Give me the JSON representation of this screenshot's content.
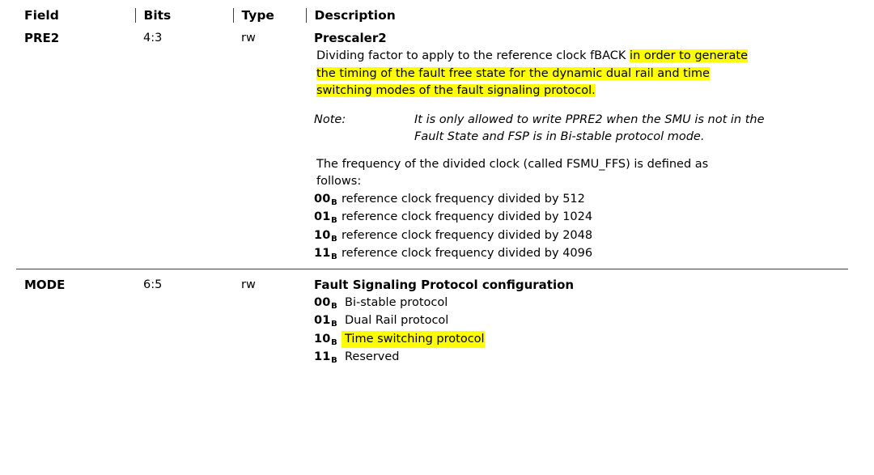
{
  "table": {
    "columns": [
      {
        "key": "field",
        "label": "Field"
      },
      {
        "key": "bits",
        "label": "Bits"
      },
      {
        "key": "type",
        "label": "Type"
      },
      {
        "key": "description",
        "label": "Description"
      }
    ],
    "rows": [
      {
        "field": "PRE2",
        "bits": "4:3",
        "type": "rw",
        "description": {
          "title": "Prescaler2",
          "intro_plain": "Dividing factor to apply to the reference clock fBACK ",
          "intro_highlight_1": "in order to generate",
          "intro_highlight_2": "the timing of the fault free state for the dynamic dual rail and time",
          "intro_highlight_3": "switching modes of the fault signaling protocol.",
          "note_label": "Note:",
          "note_line_1": "It is only allowed to write PPRE2 when the SMU is not in the",
          "note_line_2": "Fault State and FSP is in Bi-stable protocol mode.",
          "freq_line_1": "The frequency of the divided clock (called FSMU_FFS) is defined as",
          "freq_line_2": "follows:",
          "options": [
            {
              "code": "00",
              "base": "B",
              "text": "reference clock frequency divided by 512"
            },
            {
              "code": "01",
              "base": "B",
              "text": "reference clock frequency divided by 1024"
            },
            {
              "code": "10",
              "base": "B",
              "text": "reference clock frequency divided by 2048"
            },
            {
              "code": "11",
              "base": "B",
              "text": "reference clock frequency divided by 4096"
            }
          ]
        }
      },
      {
        "field": "MODE",
        "bits": "6:5",
        "type": "rw",
        "description": {
          "title": "Fault Signaling Protocol configuration",
          "options": [
            {
              "code": "00",
              "base": "B",
              "text": "Bi-stable protocol",
              "highlighted": false
            },
            {
              "code": "01",
              "base": "B",
              "text": "Dual Rail protocol",
              "highlighted": false
            },
            {
              "code": "10",
              "base": "B",
              "text": "Time switching protocol",
              "highlighted": true
            },
            {
              "code": "11",
              "base": "B",
              "text": "Reserved",
              "highlighted": false
            }
          ]
        }
      }
    ]
  },
  "colors": {
    "highlight": "#ffff00",
    "rule": "#3f3f3f",
    "text": "#000000"
  }
}
